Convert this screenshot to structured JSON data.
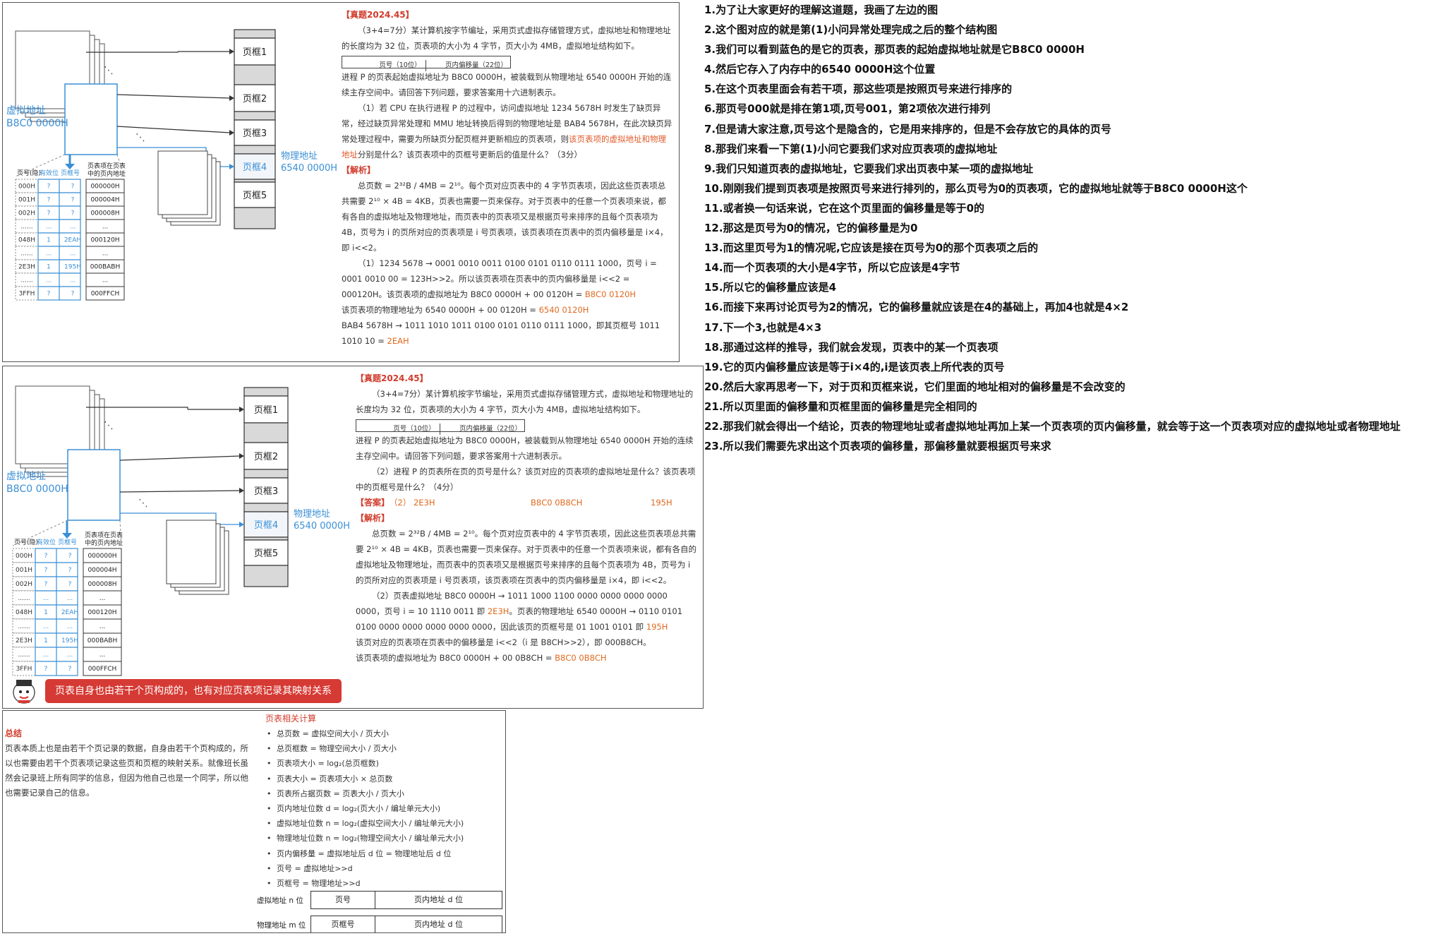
{
  "common": {
    "virtual_addr_label": "虚拟地址",
    "virtual_addr_value": "B8C0 0000H",
    "physical_addr_label": "物理地址",
    "physical_addr_value": "6540 0000H",
    "frames": [
      "页框1",
      "页框2",
      "页框3",
      "页框4",
      "页框5"
    ],
    "table_headers": [
      "页号(隐)",
      "有效位",
      "页框号",
      "页表项在页表中的页内地址"
    ],
    "addr_format": [
      "页号（10位）",
      "页内偏移量（22位）"
    ]
  },
  "panel1": {
    "table_rows": [
      [
        "000H",
        "?",
        "?",
        "000000H"
      ],
      [
        "001H",
        "?",
        "?",
        "000004H"
      ],
      [
        "002H",
        "?",
        "?",
        "000008H"
      ],
      [
        "......",
        "...",
        "...",
        "..."
      ],
      [
        "048H",
        "1",
        "2EAH",
        "000120H"
      ],
      [
        "......",
        "...",
        "...",
        "..."
      ],
      [
        "2E3H",
        "1",
        "195H",
        "000BABH"
      ],
      [
        "......",
        "...",
        "...",
        "..."
      ],
      [
        "3FFH",
        "?",
        "?",
        "000FFCH"
      ]
    ],
    "header": "【真题2024.45】",
    "q_intro1": "（3+4=7分）某计算机按字节编址，采用页式虚拟存储管理方式，虚拟地址和物理地址的长度均为 32 位，页表项的大小为 4 字节，页大小为 4MB，虚拟地址结构如下。",
    "q_intro2": "进程 P 的页表起始虚拟地址为 B8C0 0000H，被装载到从物理地址 6540 0000H 开始的连续主存空间中。请回答下列问题，要求答案用十六进制表示。",
    "q1_a": "（1）若 CPU 在执行进程 P 的过程中，访问虚拟地址 1234 5678H 时发生了缺页异常，经过缺页异常处理和 MMU 地址转换后得到的物理地址是 BAB4 5678H，在此次缺页异常处理过程中，需要为所缺页分配页框并更新相应的页表项，则",
    "q1_highlight": "该页表项的虚拟地址和物理地址",
    "q1_b": "分别是什么？该页表项中的页框号更新后的值是什么？（3分）",
    "analysis_label": "【解析】",
    "a1": "总页数 = 2³²B / 4MB = 2¹⁰。每个页对应页表中的 4 字节页表项，因此这些页表项总共需要 2¹⁰ × 4B = 4KB，页表也需要一页来保存。对于页表中的任意一个页表项来说，都有各自的虚拟地址及物理地址，而页表中的页表项又是根据页号来排序的且每个页表项为 4B，页号为 i 的页所对应的页表项是 i 号页表项，该页表项在页表中的页内偏移量是 i×4，即 i<<2。",
    "a2": "（1）1234 5678 → 0001 0010 0011 0100 0101 0110 0111 1000，页号 i = 0001 0010 00 = 123H>>2。所以该页表项在页表中的页内偏移量是 i<<2 = 000120H。该页表项的虚拟地址为 B8C0 0000H + 00 0120H =",
    "a2_v": "B8C0 0120H",
    "a3": "该页表项的物理地址为 6540 0000H + 00 0120H =",
    "a3_v": "6540 0120H",
    "a4": "BAB4 5678H → 1011 1010 1011 0100 0101 0110 0111 1000，即其页框号 1011 1010 10 =",
    "a4_v": "2EAH"
  },
  "panel2": {
    "table_rows": [
      [
        "000H",
        "?",
        "?",
        "000000H"
      ],
      [
        "001H",
        "?",
        "?",
        "000004H"
      ],
      [
        "002H",
        "?",
        "?",
        "000008H"
      ],
      [
        "......",
        "...",
        "...",
        "..."
      ],
      [
        "048H",
        "1",
        "2EAH",
        "000120H"
      ],
      [
        "......",
        "...",
        "...",
        "..."
      ],
      [
        "2E3H",
        "1",
        "195H",
        "000BABH"
      ],
      [
        "......",
        "...",
        "...",
        "..."
      ],
      [
        "3FFH",
        "?",
        "?",
        "000FFCH"
      ]
    ],
    "header": "【真题2024.45】",
    "q_intro1": "（3+4=7分）某计算机按字节编址，采用页式虚拟存储管理方式，虚拟地址和物理地址的长度均为 32 位，页表项的大小为 4 字节，页大小为 4MB，虚拟地址结构如下。",
    "q_intro2": "进程 P 的页表起始虚拟地址为 B8C0 0000H，被装载到从物理地址 6540 0000H 开始的连续主存空间中。请回答下列问题，要求答案用十六进制表示。",
    "q2": "（2）进程 P 的页表所在页的页号是什么？该页对应的页表项的虚拟地址是什么？该页表项中的页框号是什么？（4分）",
    "answer_label": "【答案】",
    "answer_vals": [
      "（2） 2E3H",
      "B8C0 0B8CH",
      "195H"
    ],
    "analysis_label": "【解析】",
    "a1": "总页数 = 2³²B / 4MB = 2¹⁰。每个页对应页表中的 4 字节页表项，因此这些页表项总共需要 2¹⁰ × 4B = 4KB，页表也需要一页来保存。对于页表中的任意一个页表项来说，都有各自的虚拟地址及物理地址，而页表中的页表项又是根据页号来排序的且每个页表项为 4B，页号为 i 的页所对应的页表项是 i 号页表项，该页表项在页表中的页内偏移量是 i×4，即 i<<2。",
    "a2": "（2）页表虚拟地址 B8C0 0000H → 1011 1000 1100 0000 0000 0000 0000 0000，页号 i = 10 1110 0011 即",
    "a2_v": "2E3H",
    "a2b": "。页表的物理地址 6540 0000H → 0110 0101 0100 0000 0000 0000 0000 0000，因此该页的页框号是 01 1001 0101 即",
    "a2b_v": "195H",
    "a3": "该页对应的页表项在页表中的偏移量是 i<<2（i 是 B8CH>>2），即 000B8CH。",
    "a4": "该页表项的虚拟地址为 B8C0 0000H + 00 0B8CH =",
    "a4_v": "B8C0 0B8CH",
    "banner": "页表自身也由若干个页构成的，也有对应页表项记录其映射关系"
  },
  "panel3": {
    "summary_title": "总结",
    "summary_text": "页表本质上也是由若干个页记录的数据，自身由若干个页构成的，所以也需要由若干个页表项记录这些页和页框的映射关系。就像班长虽然会记录班上所有同学的信息，但因为他自己也是一个同学，所以他也需要记录自己的信息。",
    "pt_title": "页表相关计算",
    "pt_items": [
      "总页数 = 虚拟空间大小 / 页大小",
      "总页框数 = 物理空间大小 / 页大小",
      "页表项大小 = log₂(总页框数)",
      "页表大小 = 页表项大小 × 总页数",
      "页表所占据页数 = 页表大小 / 页大小",
      "页内地址位数 d = log₂(页大小 / 编址单元大小)",
      "虚拟地址位数 n = log₂(虚拟空间大小 / 编址单元大小)",
      "物理地址位数 n = log₂(物理空间大小 / 编址单元大小)",
      "页内偏移量 = 虚拟地址后 d 位 = 物理地址后 d 位",
      "页号 = 虚拟地址>>d",
      "页框号 = 物理地址>>d"
    ],
    "fmt_virtual_label": "虚拟地址 n 位",
    "fmt_virtual": [
      "页号",
      "页内地址 d 位"
    ],
    "fmt_physical_label": "物理地址 m 位",
    "fmt_physical": [
      "页框号",
      "页内地址 d 位"
    ]
  },
  "notes": [
    "1.为了让大家更好的理解这道题，我画了左边的图",
    "2.这个图对应的就是第(1)小问异常处理完成之后的整个结构图",
    "3.我们可以看到蓝色的是它的页表，那页表的起始虚拟地址就是它B8C0 0000H",
    "4.然后它存入了内存中的6540 0000H这个位置",
    "5.在这个页表里面会有若干项，那这些项是按照页号来进行排序的",
    "6.那页号000就是排在第1项,页号001，第2项依次进行排列",
    "7.但是请大家注意,页号这个是隐含的，它是用来排序的，但是不会存放它的具体的页号",
    "8.那我们来看一下第(1)小问它要我们求对应页表项的虚拟地址",
    "9.我们只知道页表的虚拟地址，它要我们求出页表中某一项的虚拟地址",
    "10.刚刚我们提到页表项是按照页号来进行排列的，那么页号为0的页表项，它的虚拟地址就等于B8C0 0000H这个",
    "11.或者换一句话来说，它在这个页里面的偏移量是等于0的",
    "12.那这是页号为0的情况，它的偏移量是为0",
    "13.而这里页号为1的情况呢,它应该是接在页号为0的那个页表项之后的",
    "14.而一个页表项的大小是4字节，所以它应该是4字节",
    "15.所以它的偏移量应该是4",
    "16.而接下来再讨论页号为2的情况，它的偏移量就应该是在4的基础上，再加4也就是4×2",
    "17.下一个3,也就是4×3",
    "18.那通过这样的推导，我们就会发现，页表中的某一个页表项",
    "19.它的页内偏移量应该是等于i×4的,i是该页表上所代表的页号",
    "20.然后大家再思考一下，对于页和页框来说，它们里面的地址相对的偏移量是不会改变的",
    "21.所以页里面的偏移量和页框里面的偏移量是完全相同的",
    "22.那我们就会得出一个结论，页表的物理地址或者虚拟地址再加上某一个页表项的页内偏移量，就会等于这一个页表项对应的虚拟地址或者物理地址",
    "23.所以我们需要先求出这个页表项的偏移量，那偏移量就要根据页号来求"
  ]
}
